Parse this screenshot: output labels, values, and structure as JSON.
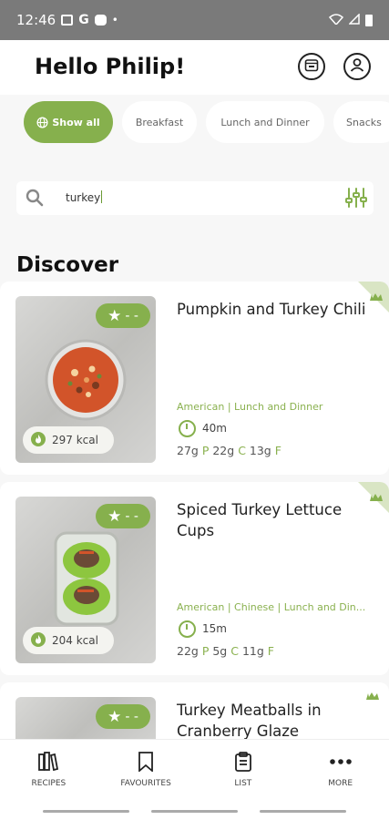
{
  "status_bar": {
    "time": "12:46",
    "g_label": "G",
    "dot": "•"
  },
  "header": {
    "greeting": "Hello Philip!"
  },
  "chips": [
    {
      "label": "Show all",
      "active": true
    },
    {
      "label": "Breakfast",
      "active": false
    },
    {
      "label": "Lunch and Dinner",
      "active": false
    },
    {
      "label": "Snacks",
      "active": false
    }
  ],
  "search": {
    "value": "turkey"
  },
  "section_title": "Discover",
  "recipes": [
    {
      "title": "Pumpkin and Turkey Chili",
      "rating": "- -",
      "kcal": "297 kcal",
      "cuisine": "American | Lunch and Dinner",
      "time": "40m",
      "protein": "27g",
      "carbs": "22g",
      "fat": "13g"
    },
    {
      "title": "Spiced Turkey Lettuce Cups",
      "rating": "- -",
      "kcal": "204 kcal",
      "cuisine": "American | Chinese | Lunch and Din...",
      "time": "15m",
      "protein": "22g",
      "carbs": "5g",
      "fat": "11g"
    },
    {
      "title": "Turkey Meatballs in Cranberry Glaze",
      "rating": "- -"
    }
  ],
  "macro_letters": {
    "p": "P",
    "c": "C",
    "f": "F"
  },
  "nav": [
    {
      "label": "RECIPES"
    },
    {
      "label": "FAVOURITES"
    },
    {
      "label": "LIST"
    },
    {
      "label": "MORE"
    }
  ],
  "colors": {
    "accent": "#86b04d",
    "status_bar": "#7a7a7a"
  }
}
